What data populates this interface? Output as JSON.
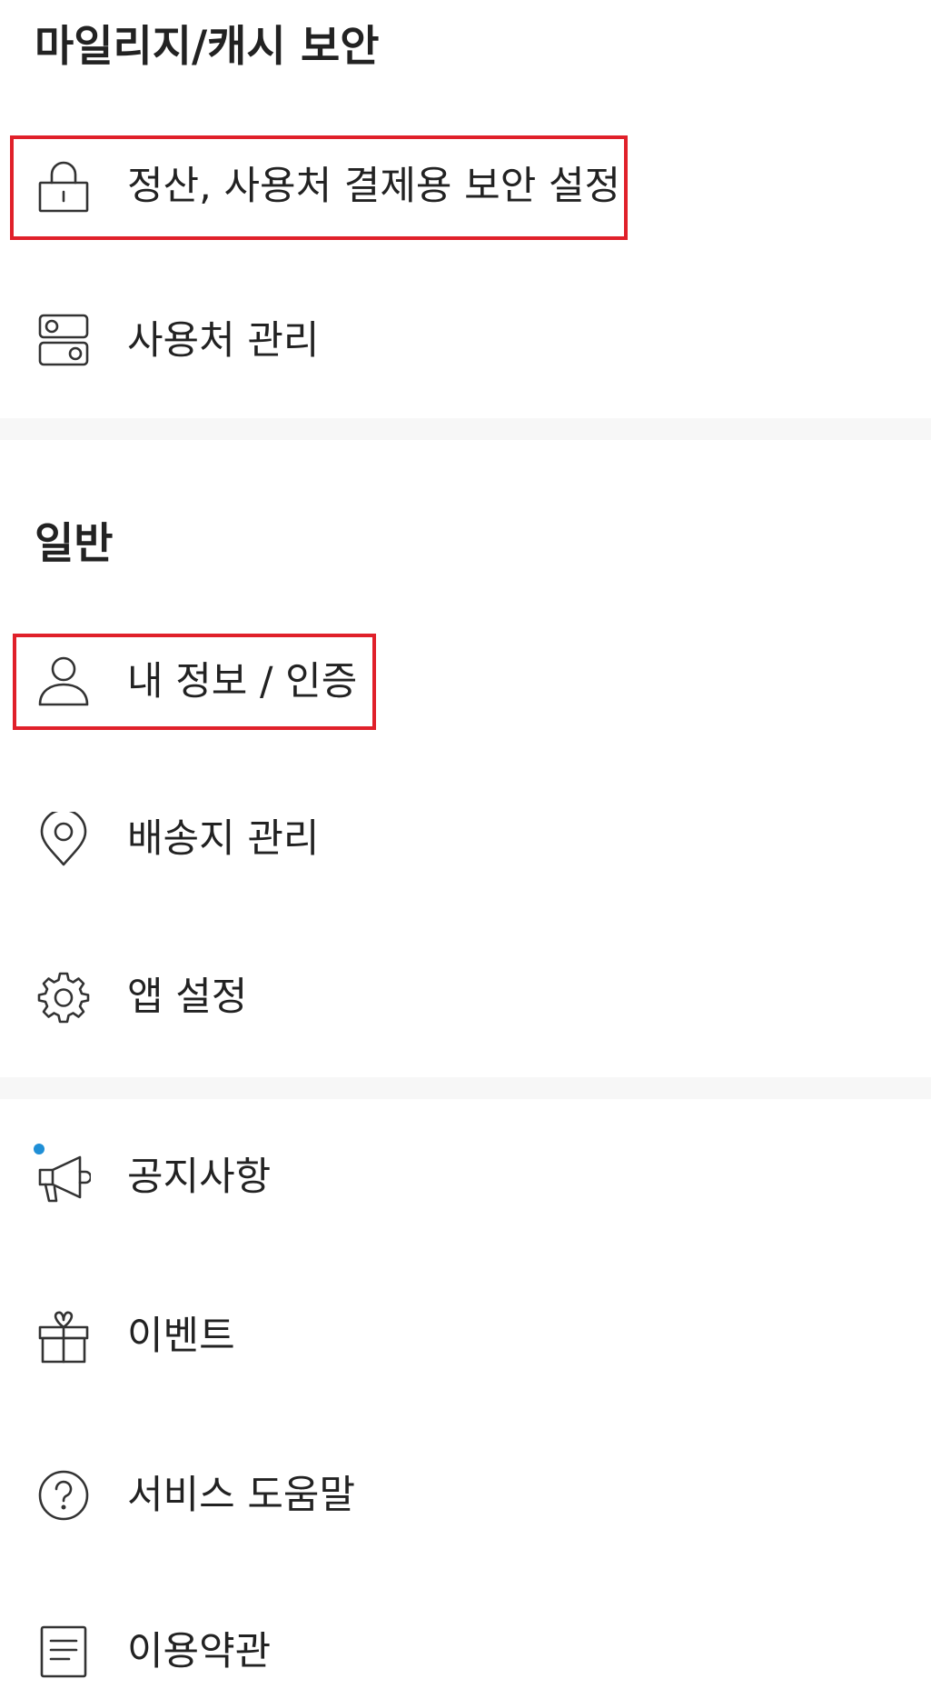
{
  "colors": {
    "text": "#222222",
    "divider": "#f7f7f7",
    "highlight": "#e0202a",
    "notice_dot": "#1f8fd6",
    "icon_stroke": "#333333"
  },
  "sections": {
    "security_title": "마일리지/캐시 보안",
    "general_title": "일반"
  },
  "menu": {
    "settlement_security": {
      "label": "정산, 사용처 결제용 보안 설정",
      "icon": "lock-icon"
    },
    "usage_management": {
      "label": "사용처 관리",
      "icon": "toggle-icon"
    },
    "my_info": {
      "label": "내 정보 / 인증",
      "icon": "user-icon"
    },
    "shipping_address": {
      "label": "배송지 관리",
      "icon": "location-pin-icon"
    },
    "app_settings": {
      "label": "앱 설정",
      "icon": "gear-icon"
    },
    "notices": {
      "label": "공지사항",
      "icon": "megaphone-icon"
    },
    "events": {
      "label": "이벤트",
      "icon": "gift-icon"
    },
    "service_help": {
      "label": "서비스 도움말",
      "icon": "help-circle-icon"
    },
    "terms": {
      "label": "이용약관",
      "icon": "document-icon"
    }
  }
}
